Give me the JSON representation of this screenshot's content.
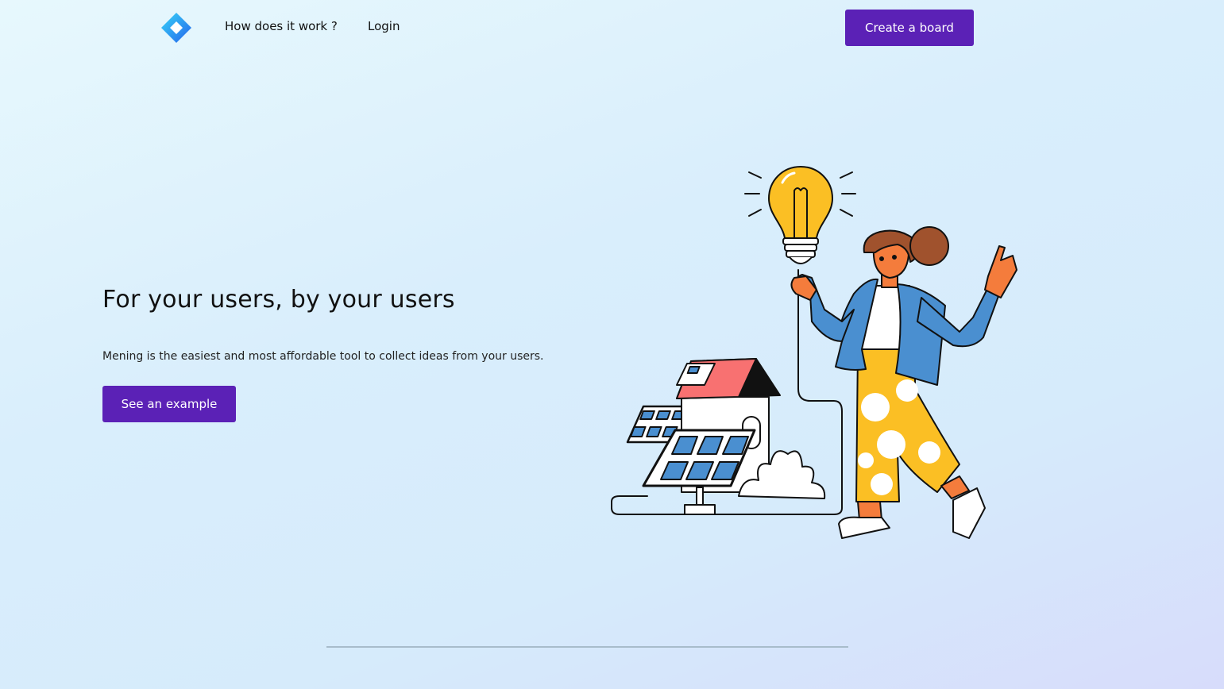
{
  "nav": {
    "links": [
      "How does it work ?",
      "Login"
    ],
    "cta": "Create a board"
  },
  "hero": {
    "title": "For your users, by your users",
    "subtitle": "Mening is the easiest and most affordable tool to collect ideas from your users.",
    "cta": "See an example"
  },
  "illustration": {
    "name": "woman-with-lightbulb-solar-house-illustration"
  },
  "colors": {
    "primary": "#5b21b6",
    "logo_light": "#38bdf8",
    "logo_dark": "#2563eb",
    "bulb": "#fbbf24",
    "jacket": "#4a8fd0",
    "roof": "#f87171",
    "skin": "#f47c3c"
  }
}
